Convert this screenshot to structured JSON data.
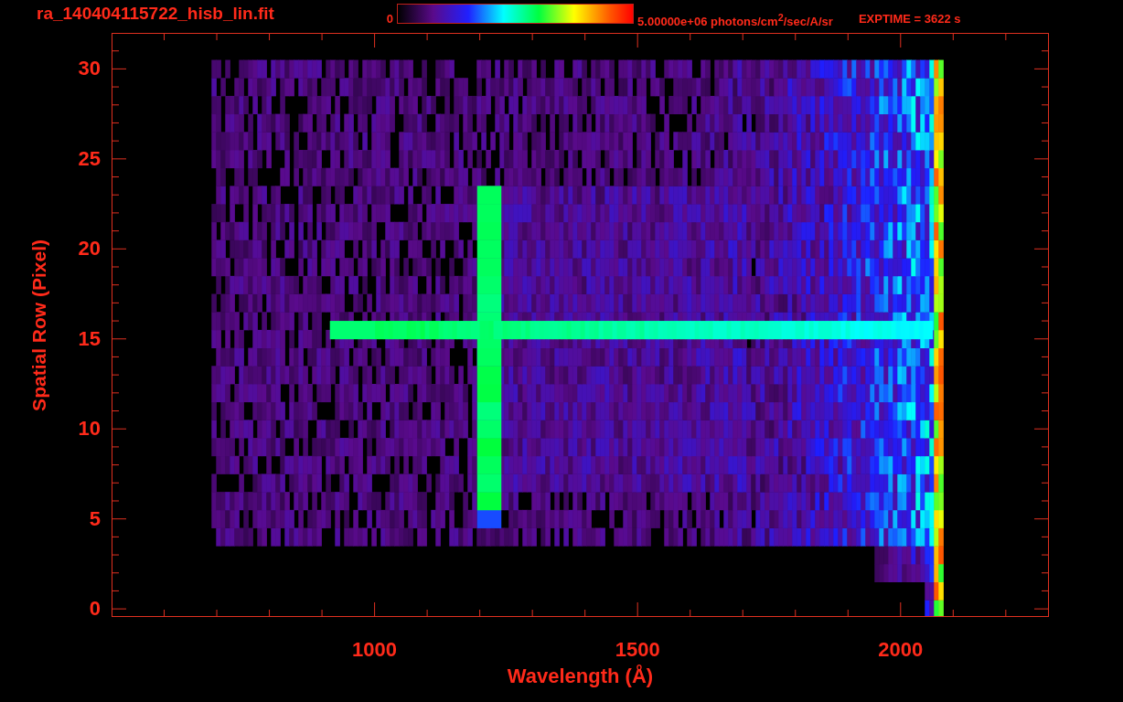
{
  "title": "ra_140404115722_hisb_lin.fit",
  "colorbar": {
    "min_label": "0",
    "max_label": "5.00000e+06 photons/cm$^{2}$/sec/A/sr"
  },
  "exposure": "EXPTIME = 3622 s",
  "plot": {
    "xlabel": "Wavelength (Å)",
    "ylabel": "Spatial Row (Pixel)",
    "xticks": [
      "1000",
      "1500",
      "2000"
    ],
    "yticks": [
      "30",
      "25",
      "20",
      "15",
      "10",
      "5",
      "0"
    ]
  }
}
